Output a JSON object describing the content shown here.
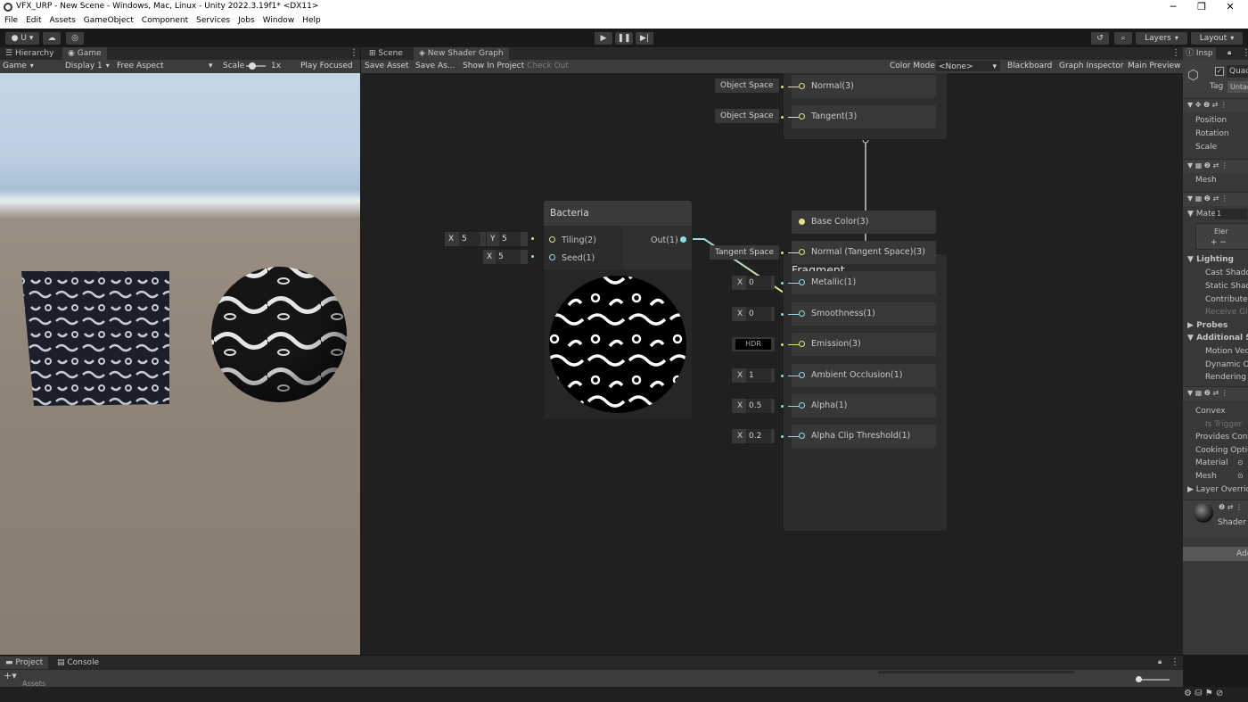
{
  "window": {
    "title": "VFX_URP - New Scene - Windows, Mac, Linux - Unity 2022.3.19f1* <DX11>",
    "minimize": "─",
    "maximize": "❐",
    "close": "✕"
  },
  "menu": [
    "File",
    "Edit",
    "Assets",
    "GameObject",
    "Component",
    "Services",
    "Jobs",
    "Window",
    "Help"
  ],
  "toolbar": {
    "account": "U",
    "layers": "Layers",
    "layout": "Layout"
  },
  "left_panel": {
    "tabs": [
      "Hierarchy",
      "Game"
    ],
    "game_dropdown": "Game",
    "display": "Display 1",
    "aspect": "Free Aspect",
    "scale_label": "Scale",
    "scale_value": "1x",
    "play_focused": "Play Focused"
  },
  "center_panel": {
    "tabs": [
      "Scene",
      "New Shader Graph"
    ],
    "buttons": [
      "Save Asset",
      "Save As...",
      "Show In Project",
      "Check Out"
    ],
    "color_mode_label": "Color Mode",
    "color_mode_value": "<None>",
    "right_buttons": [
      "Blackboard",
      "Graph Inspector",
      "Main Preview"
    ]
  },
  "graph": {
    "vertex_ports": [
      {
        "chip": "Object Space",
        "label": "Normal(3)"
      },
      {
        "chip": "Object Space",
        "label": "Tangent(3)"
      }
    ],
    "bacteria": {
      "title": "Bacteria",
      "in1": "Tiling(2)",
      "in2": "Seed(1)",
      "out": "Out(1)",
      "tiling_x_label": "X",
      "tiling_x": "5",
      "tiling_y_label": "Y",
      "tiling_y": "5",
      "seed_x_label": "X",
      "seed_x": "5"
    },
    "fragment": {
      "title": "Fragment",
      "ports": [
        {
          "label": "Base Color(3)",
          "chip_type": "none",
          "value": ""
        },
        {
          "label": "Normal (Tangent Space)(3)",
          "chip_type": "text",
          "value": "Tangent Space"
        },
        {
          "label": "Metallic(1)",
          "chip_type": "x",
          "value": "0"
        },
        {
          "label": "Smoothness(1)",
          "chip_type": "x",
          "value": "0"
        },
        {
          "label": "Emission(3)",
          "chip_type": "hdr",
          "value": "HDR"
        },
        {
          "label": "Ambient Occlusion(1)",
          "chip_type": "x",
          "value": "1"
        },
        {
          "label": "Alpha(1)",
          "chip_type": "x",
          "value": "0.5"
        },
        {
          "label": "Alpha Clip Threshold(1)",
          "chip_type": "x",
          "value": "0.2"
        }
      ]
    }
  },
  "inspector": {
    "tab": "Insp",
    "name": "Quad",
    "tag_label": "Tag",
    "tag_value": "Untag",
    "transform": [
      "Position",
      "Rotation",
      "Scale"
    ],
    "mesh_label": "Mesh",
    "materials_label": "Mate",
    "materials_count": "1",
    "element": "Eler",
    "lighting": "Lighting",
    "lighting_items": [
      "Cast Shado",
      "Static Shad",
      "Contribute",
      "Receive Glo"
    ],
    "probes": "Probes",
    "additional": "Additional Se",
    "additional_items": [
      "Motion Vect",
      "Dynamic Oc",
      "Rendering L"
    ],
    "collider_items": [
      "Convex",
      "Is Trigger",
      "Provides Cont",
      "Cooking Optio",
      "Material",
      "Mesh",
      "Layer Override"
    ],
    "shader_label": "Shader",
    "add_component": "Add C"
  },
  "bottom": {
    "tabs": [
      "Project",
      "Console"
    ],
    "assets": "Assets"
  },
  "colors": {
    "yellow_pin": "#e4e08a",
    "cyan_pin": "#8fdbe9"
  }
}
